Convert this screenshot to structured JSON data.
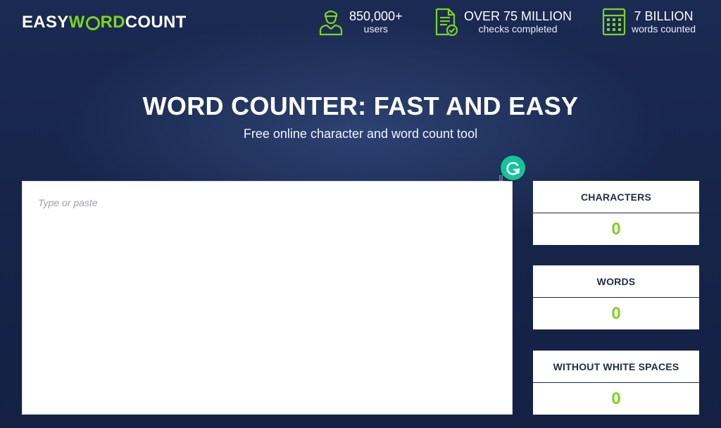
{
  "logo": {
    "part1": "EASY",
    "part2_w": "W",
    "part2_rd": "RD",
    "part3": "COUNT"
  },
  "stats": [
    {
      "icon": "user-icon",
      "big": "850,000+",
      "small": "users"
    },
    {
      "icon": "document-check-icon",
      "big": "OVER 75 MILLION",
      "small": "checks completed"
    },
    {
      "icon": "calculator-icon",
      "big": "7 BILLION",
      "small": "words counted"
    }
  ],
  "hero": {
    "title": "WORD COUNTER: FAST AND EASY",
    "subtitle": "Free online character and word count tool"
  },
  "editor": {
    "placeholder": "Type or paste",
    "value": ""
  },
  "counters": [
    {
      "label": "CHARACTERS",
      "value": "0"
    },
    {
      "label": "WORDS",
      "value": "0"
    },
    {
      "label": "WITHOUT WHITE SPACES",
      "value": "0"
    }
  ],
  "colors": {
    "accent": "#7ed321",
    "background": "#162449",
    "card_text": "#1f2c46",
    "grammarly": "#15c39a"
  }
}
